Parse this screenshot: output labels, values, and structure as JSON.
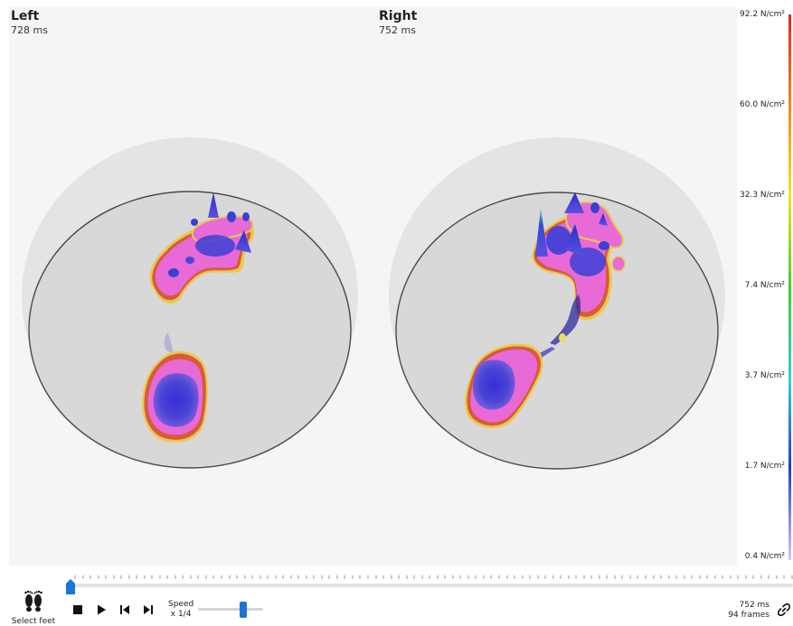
{
  "left_foot": {
    "title": "Left",
    "time": "728 ms"
  },
  "right_foot": {
    "title": "Right",
    "time": "752 ms"
  },
  "legend": {
    "unit": "N/cm²",
    "labels": [
      "92.2 N/cm²",
      "60.0 N/cm²",
      "32.3 N/cm²",
      "7.4 N/cm²",
      "3.7 N/cm²",
      "1.7 N/cm²",
      "0.4 N/cm²"
    ],
    "colors": [
      "#e8241e",
      "#f28a1c",
      "#f2e61a",
      "#3fcf2e",
      "#2fd0d6",
      "#1a3fd1",
      "#d6c8f0"
    ]
  },
  "controls": {
    "select_feet_label": "Select feet",
    "speed_label": "Speed",
    "speed_value": "x 1/4",
    "stop": "stop-icon",
    "play": "play-icon",
    "prev": "step-back-icon",
    "next": "step-forward-icon",
    "loop": "loop-icon"
  },
  "status": {
    "time": "752 ms",
    "frames": "94 frames"
  },
  "timeline": {
    "position": 0.0
  },
  "speed_slider": {
    "position": 0.72
  },
  "theme": {
    "accent": "#1e73d8",
    "pressure_low": "#e86ad6",
    "pressure_mid": "#3b3fd6",
    "pressure_high": "#2ee0c8"
  }
}
